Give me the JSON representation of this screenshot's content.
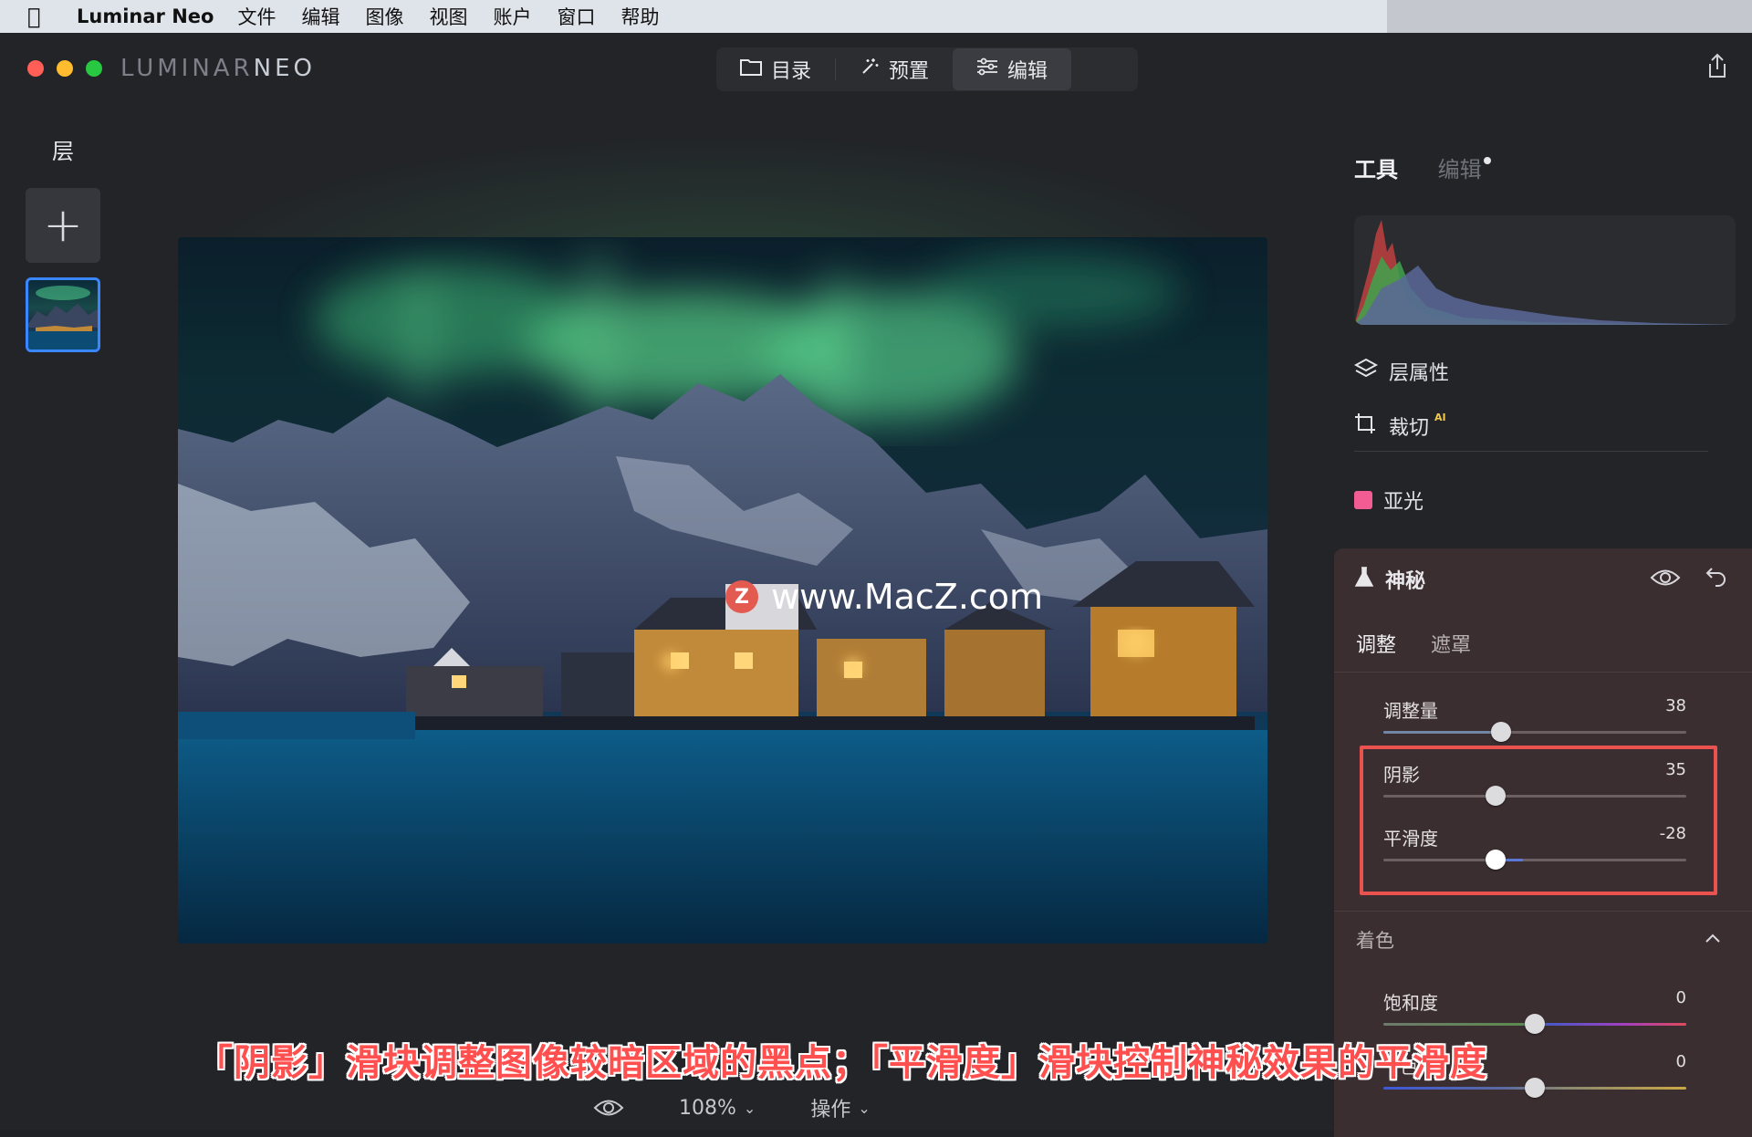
{
  "menubar": {
    "app_name": "Luminar Neo",
    "items": [
      "文件",
      "编辑",
      "图像",
      "视图",
      "账户",
      "窗口",
      "帮助"
    ]
  },
  "window": {
    "logo_left": "LUMINAR",
    "logo_right": "NEO",
    "mode_tabs": [
      {
        "label": "目录",
        "icon": "folder-icon"
      },
      {
        "label": "预置",
        "icon": "magic-wand-icon"
      },
      {
        "label": "编辑",
        "icon": "sliders-icon",
        "active": true
      }
    ]
  },
  "layers": {
    "title": "层",
    "add_label": "+"
  },
  "canvas": {
    "watermark": "www.MacZ.com",
    "watermark_badge": "Z",
    "caption": "「阴影」滑块调整图像较暗区域的黑点；「平滑度」滑块控制神秘效果的平滑度",
    "zoom": "108%",
    "actions": "操作"
  },
  "panel": {
    "tabs": {
      "tools": "工具",
      "edits": "编辑"
    },
    "nav": {
      "layer_properties": "层属性",
      "crop": "裁切",
      "crop_badge": "AI",
      "matte": "亚光"
    },
    "mystic": {
      "title": "神秘",
      "subtabs": {
        "adjust": "调整",
        "mask": "遮罩"
      },
      "sliders": {
        "amount": {
          "label": "调整量",
          "value": "38",
          "pos": 0.38
        },
        "shadows": {
          "label": "阴影",
          "value": "35",
          "pos": 0.37
        },
        "smoothness": {
          "label": "平滑度",
          "value": "-28",
          "pos": 0.37
        }
      },
      "tint": {
        "title": "着色",
        "saturation": {
          "label": "饱和度",
          "value": "0",
          "pos": 0.5
        },
        "hue": {
          "label": "色",
          "value": "0",
          "pos": 0.5
        }
      }
    }
  },
  "colors": {
    "accent_blue": "#3a86ff",
    "highlight_red": "#e9524f",
    "matte_pink": "#f35c93",
    "mystic_bg": "#3b2e31"
  }
}
